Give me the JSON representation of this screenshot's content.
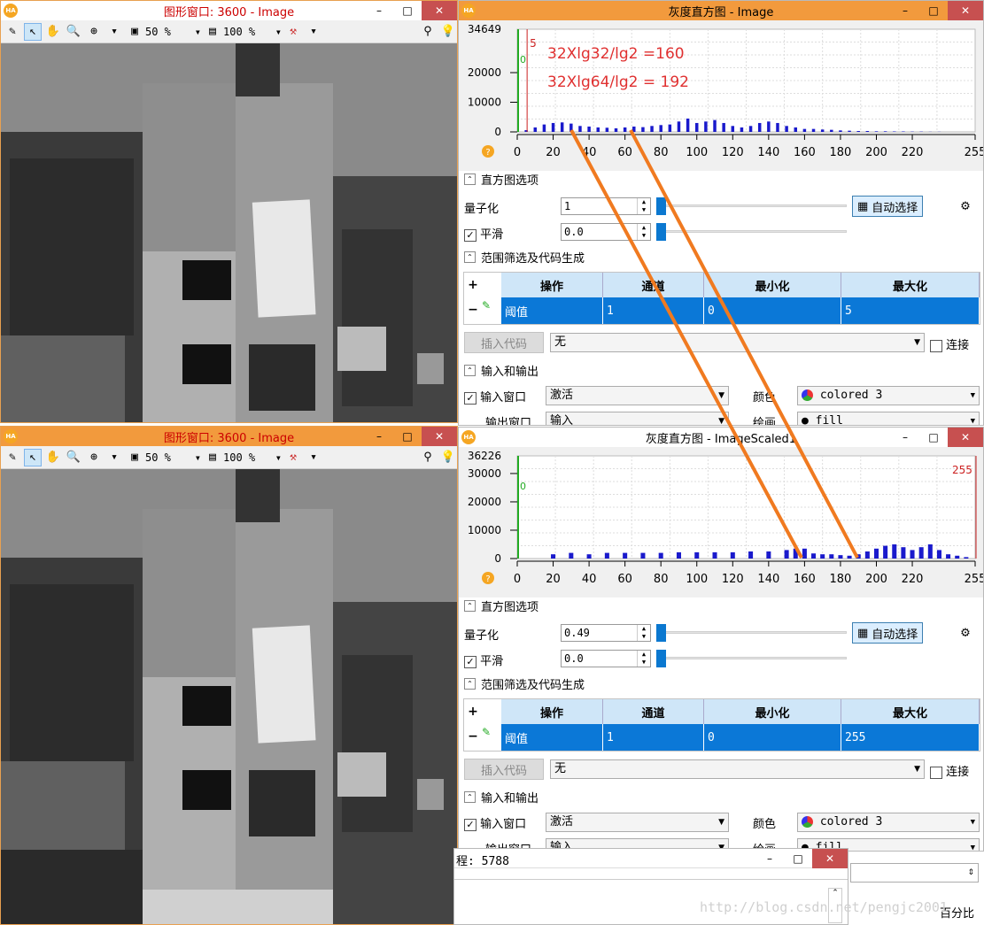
{
  "image_windows": [
    {
      "title": "图形窗口: 3600 - Image",
      "zoom_percent": "50 %",
      "scale_percent": "100 %"
    },
    {
      "title": "图形窗口: 3600 - Image",
      "zoom_percent": "50 %",
      "scale_percent": "100 %"
    }
  ],
  "histograms": [
    {
      "title": "灰度直方图 - Image",
      "y_max_label": "34649",
      "y_ticks": [
        "20000",
        "10000",
        "0"
      ],
      "min_marker": "0",
      "max_marker": "5",
      "annotations": [
        "32Xlg32/lg2 =160",
        "32Xlg64/lg2 = 192"
      ],
      "quantize_label": "量子化",
      "quantize_value": "1",
      "smooth_label": "平滑",
      "smooth_value": "0.0",
      "section_histogram": "直方图选项",
      "section_range": "范围筛选及代码生成",
      "section_io": "输入和输出",
      "auto_select": "自动选择",
      "table_headers": [
        "操作",
        "通道",
        "最小化",
        "最大化"
      ],
      "table_row": [
        "阈值",
        "1",
        "0",
        "5"
      ],
      "insert_code": "插入代码",
      "code_option": "无",
      "connect_label": "连接",
      "input_window_label": "输入窗口",
      "input_window_value": "激活",
      "output_window_label": "输出窗口",
      "output_window_value": "输入",
      "color_label": "颜色",
      "color_value": "colored 3",
      "draw_label": "绘画",
      "draw_value": "fill"
    },
    {
      "title": "灰度直方图 - ImageScaled1",
      "y_max_label": "36226",
      "y_ticks": [
        "30000",
        "20000",
        "10000",
        "0"
      ],
      "min_marker": "0",
      "max_marker": "255",
      "annotations": [],
      "quantize_label": "量子化",
      "quantize_value": "0.49",
      "smooth_label": "平滑",
      "smooth_value": "0.0",
      "section_histogram": "直方图选项",
      "section_range": "范围筛选及代码生成",
      "section_io": "输入和输出",
      "auto_select": "自动选择",
      "table_headers": [
        "操作",
        "通道",
        "最小化",
        "最大化"
      ],
      "table_row": [
        "阈值",
        "1",
        "0",
        "255"
      ],
      "insert_code": "插入代码",
      "code_option": "无",
      "connect_label": "连接",
      "input_window_label": "输入窗口",
      "input_window_value": "激活",
      "output_window_label": "输出窗口",
      "output_window_value": "输入",
      "color_label": "颜色",
      "color_value": "colored 3",
      "draw_label": "绘画",
      "draw_value": "fill"
    }
  ],
  "x_ticks": [
    "0",
    "20",
    "40",
    "60",
    "80",
    "100",
    "120",
    "140",
    "160",
    "180",
    "200",
    "220",
    "255"
  ],
  "bottom_window": {
    "text": "程: 5788",
    "percent_label": "百分比",
    "watermark": "http://blog.csdn.net/pengjc2001"
  },
  "colors": {
    "accent_orange": "#f29a3d",
    "selection_blue": "#0b78d7",
    "histogram_blue": "#1a1acc",
    "annotation_red": "#e03030",
    "arrow_orange": "#f07a20"
  },
  "chart_data": [
    {
      "type": "bar",
      "title": "灰度直方图 - Image",
      "xlim": [
        0,
        255
      ],
      "ylim": [
        0,
        34649
      ],
      "x": [
        0,
        5,
        10,
        15,
        20,
        25,
        30,
        35,
        40,
        45,
        50,
        55,
        60,
        65,
        70,
        75,
        80,
        85,
        90,
        95,
        100,
        105,
        110,
        115,
        120,
        125,
        130,
        135,
        140,
        145,
        150,
        155,
        160,
        165,
        170,
        175,
        180,
        185,
        190,
        195,
        200,
        205,
        210,
        215,
        220,
        225,
        230,
        235,
        240,
        245,
        250,
        255
      ],
      "values": [
        0,
        600,
        1500,
        2500,
        3000,
        3200,
        2800,
        2000,
        1800,
        1500,
        1400,
        1200,
        1500,
        1800,
        1600,
        2000,
        2300,
        2500,
        3500,
        4500,
        3000,
        3500,
        4000,
        3000,
        2000,
        1500,
        2000,
        3000,
        3500,
        3000,
        2000,
        1500,
        1000,
        1000,
        800,
        700,
        500,
        400,
        300,
        300,
        200,
        200,
        150,
        150,
        100,
        100,
        50,
        50,
        0,
        0,
        0,
        0
      ]
    },
    {
      "type": "bar",
      "title": "灰度直方图 - ImageScaled1",
      "xlim": [
        0,
        255
      ],
      "ylim": [
        0,
        36226
      ],
      "x": [
        0,
        20,
        30,
        40,
        50,
        60,
        70,
        80,
        90,
        100,
        110,
        120,
        130,
        140,
        150,
        155,
        160,
        165,
        170,
        175,
        180,
        185,
        190,
        195,
        200,
        205,
        210,
        215,
        220,
        225,
        230,
        235,
        240,
        245,
        250,
        255
      ],
      "values": [
        0,
        1500,
        2000,
        1500,
        2000,
        2000,
        2000,
        2000,
        2200,
        2200,
        2200,
        2200,
        2500,
        2500,
        3000,
        3500,
        3500,
        1800,
        1500,
        1500,
        1200,
        1000,
        1500,
        2500,
        3500,
        4500,
        5000,
        4000,
        3000,
        4000,
        5000,
        3000,
        1500,
        1000,
        500,
        0
      ]
    }
  ]
}
